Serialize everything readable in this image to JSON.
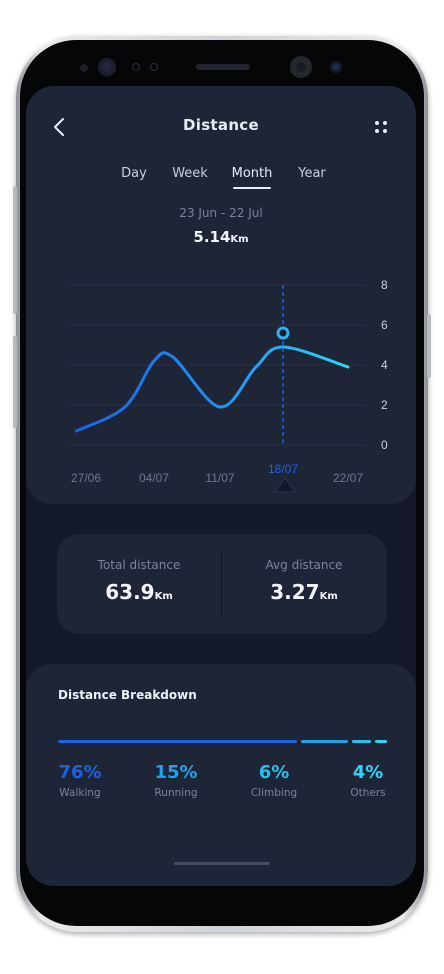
{
  "header": {
    "title": "Distance"
  },
  "tabs": [
    {
      "label": "Day",
      "active": false
    },
    {
      "label": "Week",
      "active": false
    },
    {
      "label": "Month",
      "active": true
    },
    {
      "label": "Year",
      "active": false
    }
  ],
  "summary": {
    "date_range": "23 Jun - 22 Jul",
    "total_value": "5.14",
    "total_unit": "Km"
  },
  "chart_data": {
    "type": "line",
    "x_labels": [
      "27/06",
      "04/07",
      "11/07",
      "18/07",
      "22/07"
    ],
    "selected_x_label": "18/07",
    "y_ticks": [
      "8",
      "6",
      "4",
      "2",
      "0"
    ],
    "ylim": [
      0,
      8
    ],
    "series": [
      {
        "points": [
          {
            "x": "26/06",
            "y": 0.7
          },
          {
            "x": "01/07",
            "y": 1.9
          },
          {
            "x": "04/07",
            "y": 4.2
          },
          {
            "x": "06/07",
            "y": 4.4
          },
          {
            "x": "11/07",
            "y": 1.9
          },
          {
            "x": "15/07",
            "y": 3.9
          },
          {
            "x": "18/07",
            "y": 4.9
          },
          {
            "x": "22/07",
            "y": 3.9
          }
        ]
      }
    ],
    "highlight": {
      "x": "18/07",
      "y": 5.6
    }
  },
  "stats": {
    "total": {
      "label": "Total distance",
      "value": "63.9",
      "unit": "Km"
    },
    "avg": {
      "label": "Avg distance",
      "value": "3.27",
      "unit": "Km"
    }
  },
  "breakdown": {
    "title": "Distance Breakdown",
    "items": [
      {
        "percent": "76%",
        "label": "Walking",
        "fraction": 0.76,
        "color": "#1b63e6"
      },
      {
        "percent": "15%",
        "label": "Running",
        "fraction": 0.15,
        "color": "#1ea2e8"
      },
      {
        "percent": "6%",
        "label": "Climbing",
        "fraction": 0.06,
        "color": "#25c0f2"
      },
      {
        "percent": "4%",
        "label": "Others",
        "fraction": 0.04,
        "color": "#2ed5fb"
      }
    ]
  },
  "colors": {
    "background": "#14192a",
    "card": "#1e2537",
    "accent_blue": "#1b63e6",
    "accent_cyan": "#2ed5fb"
  }
}
